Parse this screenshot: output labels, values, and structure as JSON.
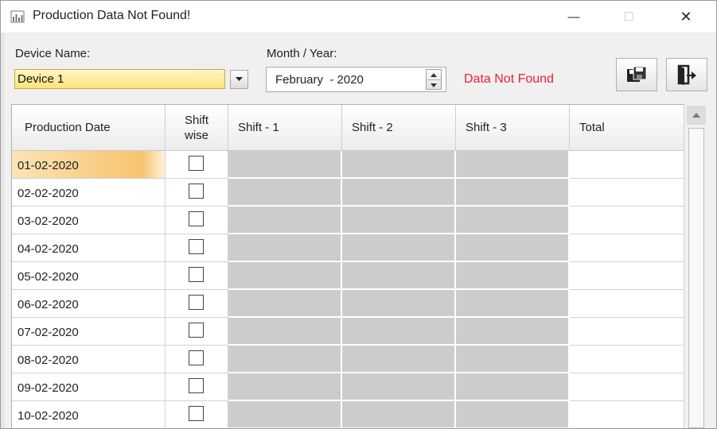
{
  "window": {
    "title": "Production Data Not Found!"
  },
  "titlebar_buttons": {
    "minimize": "—",
    "maximize": "☐",
    "close": "✕"
  },
  "form": {
    "device_label": "Device Name:",
    "device_value": "Device 1",
    "month_label": "Month / Year:",
    "month_value": "February  - 2020",
    "status_text": "Data Not Found",
    "status_color": "#e8213a"
  },
  "toolbar": {
    "save_icon": "save-disk-icon",
    "exit_icon": "exit-door-icon"
  },
  "table": {
    "columns": [
      "Production Date",
      "Shift wise",
      "Shift - 1",
      "Shift - 2",
      "Shift - 3",
      "Total"
    ],
    "rows": [
      {
        "date": "01-02-2020",
        "shift_wise": false
      },
      {
        "date": "02-02-2020",
        "shift_wise": false
      },
      {
        "date": "03-02-2020",
        "shift_wise": false
      },
      {
        "date": "04-02-2020",
        "shift_wise": false
      },
      {
        "date": "05-02-2020",
        "shift_wise": false
      },
      {
        "date": "06-02-2020",
        "shift_wise": false
      },
      {
        "date": "07-02-2020",
        "shift_wise": false
      },
      {
        "date": "08-02-2020",
        "shift_wise": false
      },
      {
        "date": "09-02-2020",
        "shift_wise": false
      },
      {
        "date": "10-02-2020",
        "shift_wise": false
      }
    ],
    "selected_row": 0
  },
  "colors": {
    "selection": "#f7c46e",
    "disabled_cell": "#cccccc",
    "device_highlight": "#ffe27a"
  }
}
